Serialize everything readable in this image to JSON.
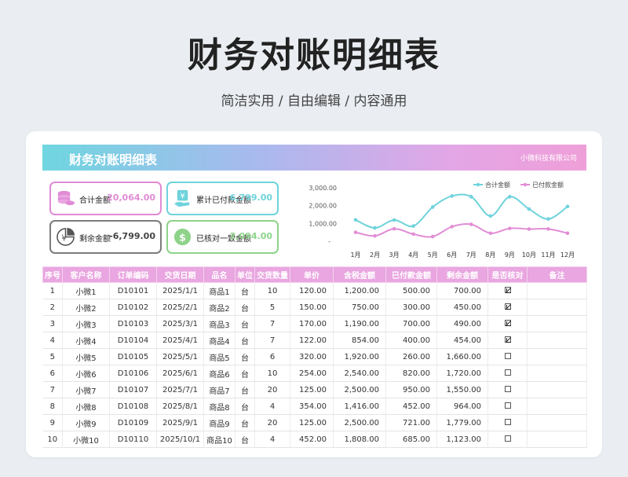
{
  "header": {
    "title": "财务对账明细表",
    "subtitle": "简洁实用 / 自由编辑 / 内容通用"
  },
  "sheet": {
    "banner_title": "财务对账明细表",
    "company": "小微科技有限公司"
  },
  "stats": [
    {
      "label": "合计金额",
      "value": "20,064.00",
      "color": "#e08bd5",
      "icon": "coins-stack-icon"
    },
    {
      "label": "累计已付款金额",
      "value": "6,799.00",
      "color": "#6ed3dc",
      "icon": "yen-money-hand-icon"
    },
    {
      "label": "剩余金额",
      "value": "-6,799.00",
      "color": "#7c7c7c",
      "icon": "yen-coin-pie-icon"
    },
    {
      "label": "已核对一致金额",
      "value": "2,094.00",
      "color": "#8ed38a",
      "icon": "dollar-coin-icon"
    }
  ],
  "chart_data": {
    "type": "line",
    "categories": [
      "1月",
      "2月",
      "3月",
      "4月",
      "5月",
      "6月",
      "7月",
      "8月",
      "9月",
      "10月",
      "11月",
      "12月"
    ],
    "y_ticks": [
      "3,000.00",
      "2,000.00",
      "1,000.00",
      "-"
    ],
    "ylim": [
      0,
      3000
    ],
    "legend_position": "top-right",
    "series": [
      {
        "name": "合计金额",
        "color": "#6fd3dc",
        "values": [
          1200,
          750,
          1190,
          854,
          1920,
          2540,
          2500,
          1416,
          2500,
          1808,
          1250,
          1950
        ]
      },
      {
        "name": "已付款金额",
        "color": "#e28dd6",
        "values": [
          500,
          300,
          700,
          400,
          260,
          820,
          950,
          452,
          721,
          685,
          690,
          452
        ]
      }
    ]
  },
  "table": {
    "columns": [
      "序号",
      "客户名称",
      "订单编码",
      "交货日期",
      "品名",
      "单位",
      "交货数量",
      "单价",
      "含税金额",
      "已付款金额",
      "剩余金额",
      "是否核对",
      "备注"
    ],
    "rows": [
      [
        "1",
        "小微1",
        "D10101",
        "2025/1/1",
        "商品1",
        "台",
        "10",
        "120.00",
        "1,200.00",
        "500.00",
        "700.00",
        true,
        ""
      ],
      [
        "2",
        "小微2",
        "D10102",
        "2025/2/1",
        "商品2",
        "台",
        "5",
        "150.00",
        "750.00",
        "300.00",
        "450.00",
        true,
        ""
      ],
      [
        "3",
        "小微3",
        "D10103",
        "2025/3/1",
        "商品3",
        "台",
        "7",
        "170.00",
        "1,190.00",
        "700.00",
        "490.00",
        true,
        ""
      ],
      [
        "4",
        "小微4",
        "D10104",
        "2025/4/1",
        "商品4",
        "台",
        "7",
        "122.00",
        "854.00",
        "400.00",
        "454.00",
        true,
        ""
      ],
      [
        "5",
        "小微5",
        "D10105",
        "2025/5/1",
        "商品5",
        "台",
        "6",
        "320.00",
        "1,920.00",
        "260.00",
        "1,660.00",
        false,
        ""
      ],
      [
        "6",
        "小微6",
        "D10106",
        "2025/6/1",
        "商品6",
        "台",
        "10",
        "254.00",
        "2,540.00",
        "820.00",
        "1,720.00",
        false,
        ""
      ],
      [
        "7",
        "小微7",
        "D10107",
        "2025/7/1",
        "商品7",
        "台",
        "20",
        "125.00",
        "2,500.00",
        "950.00",
        "1,550.00",
        false,
        ""
      ],
      [
        "8",
        "小微8",
        "D10108",
        "2025/8/1",
        "商品8",
        "台",
        "4",
        "354.00",
        "1,416.00",
        "452.00",
        "964.00",
        false,
        ""
      ],
      [
        "9",
        "小微9",
        "D10109",
        "2025/9/1",
        "商品9",
        "台",
        "20",
        "125.00",
        "2,500.00",
        "721.00",
        "1,779.00",
        false,
        ""
      ],
      [
        "10",
        "小微10",
        "D10110",
        "2025/10/1",
        "商品10",
        "台",
        "4",
        "452.00",
        "1,808.00",
        "685.00",
        "1,123.00",
        false,
        ""
      ]
    ]
  }
}
